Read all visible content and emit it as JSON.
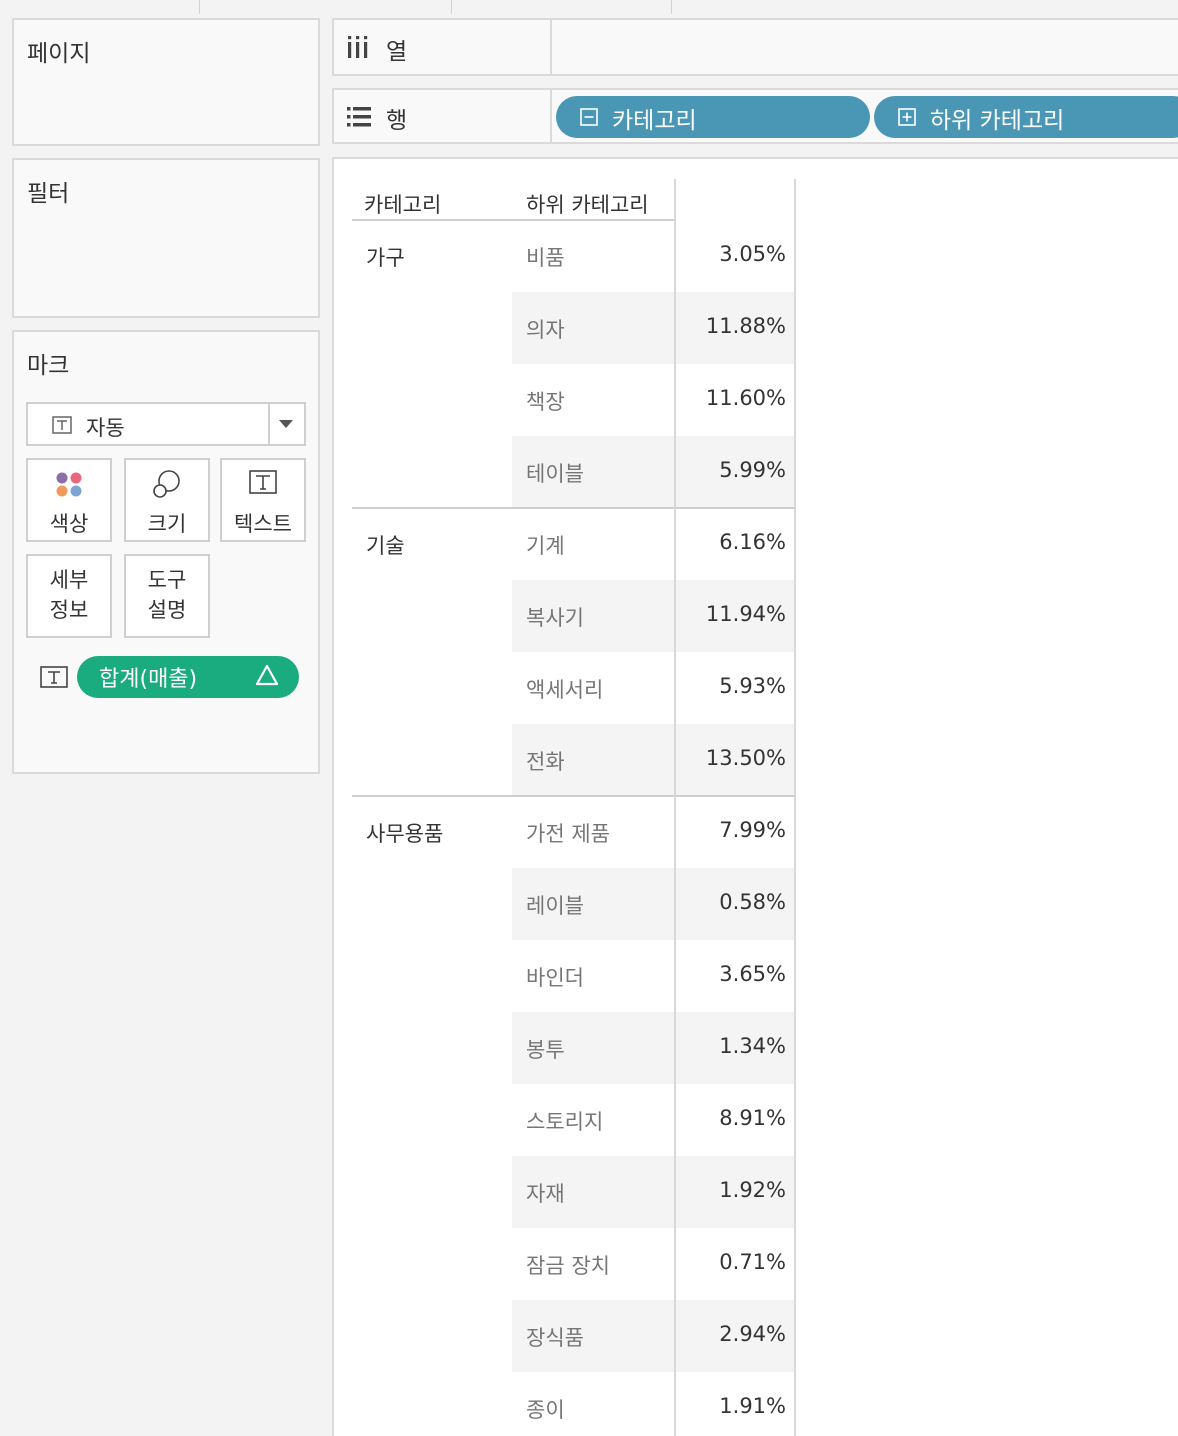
{
  "pages_card": {
    "title": "페이지"
  },
  "filters_card": {
    "title": "필터"
  },
  "marks_card": {
    "title": "마크",
    "mark_type": "자동",
    "buttons": [
      {
        "label": "색상",
        "icon": "color-dots-icon"
      },
      {
        "label": "크기",
        "icon": "size-circles-icon"
      },
      {
        "label": "텍스트",
        "icon": "text-t-icon"
      },
      {
        "label": "세부",
        "label2": "정보",
        "icon": ""
      },
      {
        "label": "도구",
        "label2": "설명",
        "icon": ""
      }
    ],
    "field_pill": {
      "label": "합계(매출)",
      "badge": "Δ",
      "color": "#1aab7e"
    }
  },
  "columns_shelf": {
    "label": "열",
    "icon": "columns-icon"
  },
  "rows_shelf": {
    "label": "행",
    "icon": "rows-icon",
    "pills": [
      {
        "label": "카테고리",
        "icon": "collapse-minus-icon"
      },
      {
        "label": "하위 카테고리",
        "icon": "expand-plus-icon"
      }
    ],
    "pill_color": "#4a97b5"
  },
  "chart_data": {
    "type": "table",
    "columns": [
      "카테고리",
      "하위 카테고리"
    ],
    "groups": [
      {
        "category": "가구",
        "rows": [
          {
            "sub": "비품",
            "value": "3.05%"
          },
          {
            "sub": "의자",
            "value": "11.88%"
          },
          {
            "sub": "책장",
            "value": "11.60%"
          },
          {
            "sub": "테이블",
            "value": "5.99%"
          }
        ]
      },
      {
        "category": "기술",
        "rows": [
          {
            "sub": "기계",
            "value": "6.16%"
          },
          {
            "sub": "복사기",
            "value": "11.94%"
          },
          {
            "sub": "액세서리",
            "value": "5.93%"
          },
          {
            "sub": "전화",
            "value": "13.50%"
          }
        ]
      },
      {
        "category": "사무용품",
        "rows": [
          {
            "sub": "가전 제품",
            "value": "7.99%"
          },
          {
            "sub": "레이블",
            "value": "0.58%"
          },
          {
            "sub": "바인더",
            "value": "3.65%"
          },
          {
            "sub": "봉투",
            "value": "1.34%"
          },
          {
            "sub": "스토리지",
            "value": "8.91%"
          },
          {
            "sub": "자재",
            "value": "1.92%"
          },
          {
            "sub": "잠금 장치",
            "value": "0.71%"
          },
          {
            "sub": "장식품",
            "value": "2.94%"
          },
          {
            "sub": "종이",
            "value": "1.91%"
          }
        ]
      }
    ]
  }
}
